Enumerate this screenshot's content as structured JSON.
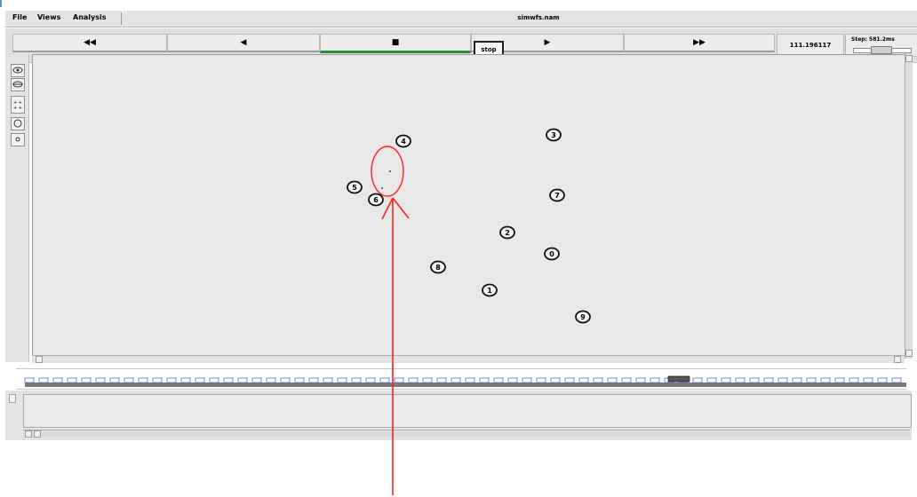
{
  "menu": {
    "file": "File",
    "views": "Views",
    "analysis": "Analysis"
  },
  "window": {
    "file_name": "simwfs.nam"
  },
  "controls": {
    "rewind_fast": "◀◀",
    "rewind": "◀",
    "stop": "■",
    "play": "▶",
    "forward_fast": "▶▶",
    "stop_tooltip": "stop",
    "time": "111.196117",
    "step": "Step: 581.2ms"
  },
  "tools": [
    "eye-icon",
    "eye-alt-icon",
    "grid-icon",
    "circle-icon",
    "dot-icon"
  ],
  "nodes": [
    {
      "label": "4"
    },
    {
      "label": "3"
    },
    {
      "label": "5"
    },
    {
      "label": "6"
    },
    {
      "label": "7"
    },
    {
      "label": "2"
    },
    {
      "label": "0"
    },
    {
      "label": "8"
    },
    {
      "label": "1"
    },
    {
      "label": "9"
    }
  ],
  "annotation": {
    "color": "#ff2020",
    "shape": "ellipse-with-arrow"
  },
  "colors": {
    "accent_green": "#2b8a3e",
    "timeline_blue": "#5a6fd6",
    "timeline_gray": "#7a7a7a"
  }
}
